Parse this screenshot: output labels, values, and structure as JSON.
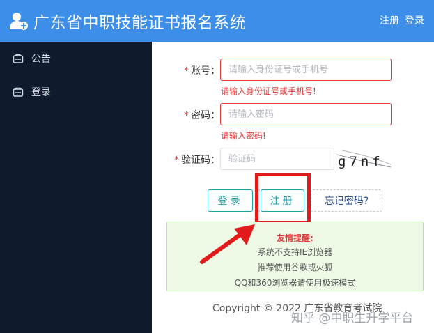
{
  "header": {
    "title": "广东省中职技能证书报名系统",
    "register_link": "注册",
    "login_link": "登录",
    "logo_icon": "user-add-icon",
    "bg_color": "#3d8ee8"
  },
  "sidebar": {
    "bg_color": "#0f1b2d",
    "items": [
      {
        "label": "公告",
        "icon": "folder-icon"
      },
      {
        "label": "登录",
        "icon": "folder-icon"
      }
    ]
  },
  "form": {
    "account": {
      "label": "账号：",
      "placeholder": "请输入身份证号或手机号",
      "value": "",
      "error": "请输入身份证号或手机号!"
    },
    "password": {
      "label": "密码：",
      "placeholder": "请输入密码",
      "value": "",
      "error": "请输入密码!"
    },
    "captcha": {
      "label": "验证码：",
      "placeholder": "验证码",
      "value": "",
      "image_text": "g7nf"
    },
    "required_mark": "*"
  },
  "buttons": {
    "login": "登录",
    "register": "注册",
    "forgot": "忘记密码?"
  },
  "notice": {
    "title": "友情提醒:",
    "lines": [
      "系统不支持IE浏览器",
      "推荐使用谷歌或火狐",
      "QQ和360浏览器请使用极速模式"
    ]
  },
  "footer": {
    "copyright": "Copyright © 2022 广东省教育考试院"
  },
  "watermark": "知乎 @中职生升学平台",
  "colors": {
    "accent": "#1ba0a8",
    "error": "#e23a3a",
    "highlight": "#e11b1b",
    "notice_bg": "#eefae6"
  }
}
